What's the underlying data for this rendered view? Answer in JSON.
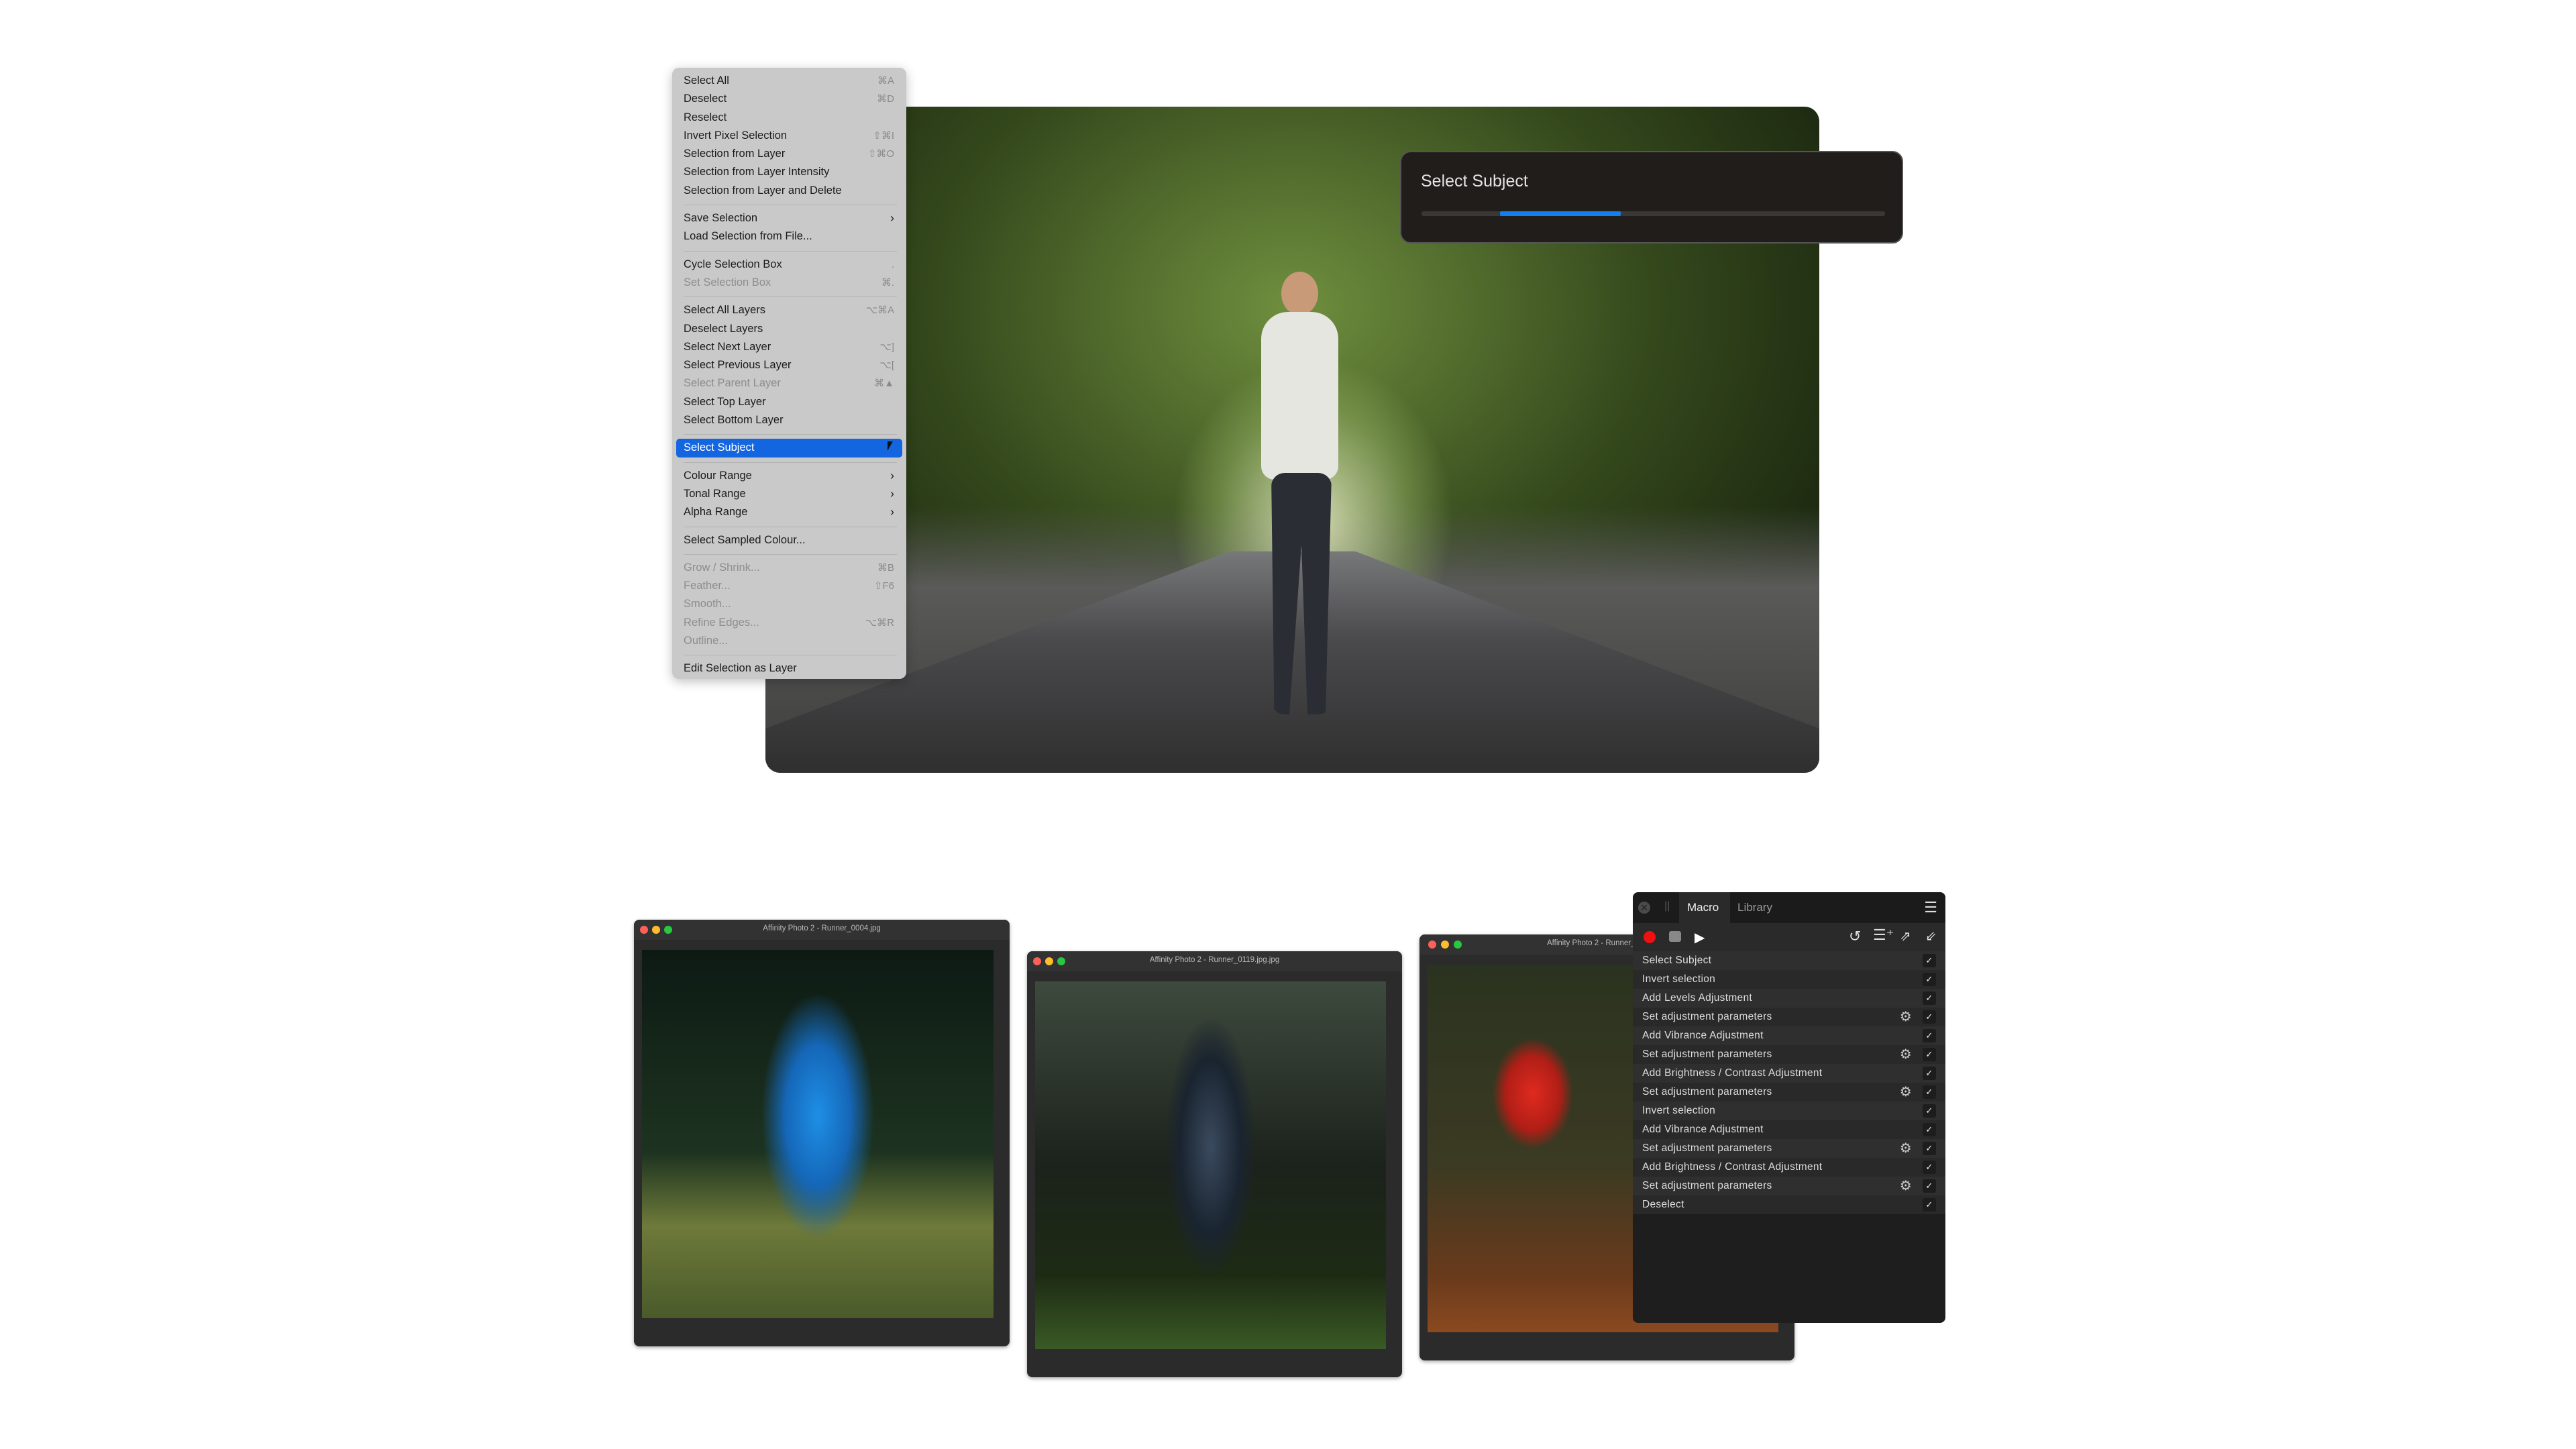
{
  "menu": {
    "items": [
      {
        "label": "Select All",
        "shortcut": "⌘A"
      },
      {
        "label": "Deselect",
        "shortcut": "⌘D"
      },
      {
        "label": "Reselect",
        "shortcut": ""
      },
      {
        "label": "Invert Pixel Selection",
        "shortcut": "⇧⌘I"
      },
      {
        "label": "Selection from Layer",
        "shortcut": "⇧⌘O"
      },
      {
        "label": "Selection from Layer Intensity",
        "shortcut": ""
      },
      {
        "label": "Selection from Layer and Delete",
        "shortcut": ""
      },
      {
        "separator": true
      },
      {
        "label": "Save Selection",
        "submenu": true
      },
      {
        "label": "Load Selection from File...",
        "shortcut": ""
      },
      {
        "separator": true
      },
      {
        "label": "Cycle Selection Box",
        "shortcut": "."
      },
      {
        "label": "Set Selection Box",
        "shortcut": "⌘.",
        "disabled": true
      },
      {
        "separator": true
      },
      {
        "label": "Select All Layers",
        "shortcut": "⌥⌘A"
      },
      {
        "label": "Deselect Layers",
        "shortcut": ""
      },
      {
        "label": "Select Next Layer",
        "shortcut": "⌥]"
      },
      {
        "label": "Select Previous Layer",
        "shortcut": "⌥["
      },
      {
        "label": "Select Parent Layer",
        "shortcut": "⌘▲",
        "disabled": true
      },
      {
        "label": "Select Top Layer",
        "shortcut": ""
      },
      {
        "label": "Select Bottom Layer",
        "shortcut": ""
      },
      {
        "separator": true
      },
      {
        "label": "Select Subject",
        "highlighted": true
      },
      {
        "separator": true
      },
      {
        "label": "Colour Range",
        "submenu": true
      },
      {
        "label": "Tonal Range",
        "submenu": true
      },
      {
        "label": "Alpha Range",
        "submenu": true
      },
      {
        "separator": true
      },
      {
        "label": "Select Sampled Colour...",
        "shortcut": ""
      },
      {
        "separator": true
      },
      {
        "label": "Grow / Shrink...",
        "shortcut": "⌘B",
        "disabled": true
      },
      {
        "label": "Feather...",
        "shortcut": "⇧F6",
        "disabled": true
      },
      {
        "label": "Smooth...",
        "shortcut": "",
        "disabled": true
      },
      {
        "label": "Refine Edges...",
        "shortcut": "⌥⌘R",
        "disabled": true
      },
      {
        "label": "Outline...",
        "shortcut": "",
        "disabled": true
      },
      {
        "separator": true
      },
      {
        "label": "Edit Selection as Layer",
        "shortcut": ""
      }
    ]
  },
  "progress_dialog": {
    "title": "Select Subject",
    "state": "indeterminate",
    "accent": "#137ef0"
  },
  "windows": [
    {
      "title": "Affinity Photo 2 - Runner_0004.jpg"
    },
    {
      "title": "Affinity Photo 2 - Runner_0119.jpg.jpg"
    },
    {
      "title": "Affinity Photo 2 - Runner_"
    }
  ],
  "macro_panel": {
    "tabs": [
      "Macro",
      "Library"
    ],
    "active_tab": "Macro",
    "toolbar_icons": [
      "record-icon",
      "stop-icon",
      "play-icon",
      "undo-icon",
      "add-to-library-icon",
      "export-icon",
      "import-icon"
    ],
    "rows": [
      {
        "label": "Select Subject",
        "gear": false
      },
      {
        "label": "Invert selection",
        "gear": false
      },
      {
        "label": "Add Levels Adjustment",
        "gear": false
      },
      {
        "label": "Set adjustment parameters",
        "gear": true
      },
      {
        "label": "Add Vibrance Adjustment",
        "gear": false
      },
      {
        "label": "Set adjustment parameters",
        "gear": true
      },
      {
        "label": "Add Brightness / Contrast Adjustment",
        "gear": false
      },
      {
        "label": "Set adjustment parameters",
        "gear": true
      },
      {
        "label": "Invert selection",
        "gear": false
      },
      {
        "label": "Add Vibrance Adjustment",
        "gear": false
      },
      {
        "label": "Set adjustment parameters",
        "gear": true
      },
      {
        "label": "Add Brightness / Contrast Adjustment",
        "gear": false
      },
      {
        "label": "Set adjustment parameters",
        "gear": true
      },
      {
        "label": "Deselect",
        "gear": false
      }
    ],
    "check_glyph": "✓",
    "gear_glyph": "⚙"
  }
}
